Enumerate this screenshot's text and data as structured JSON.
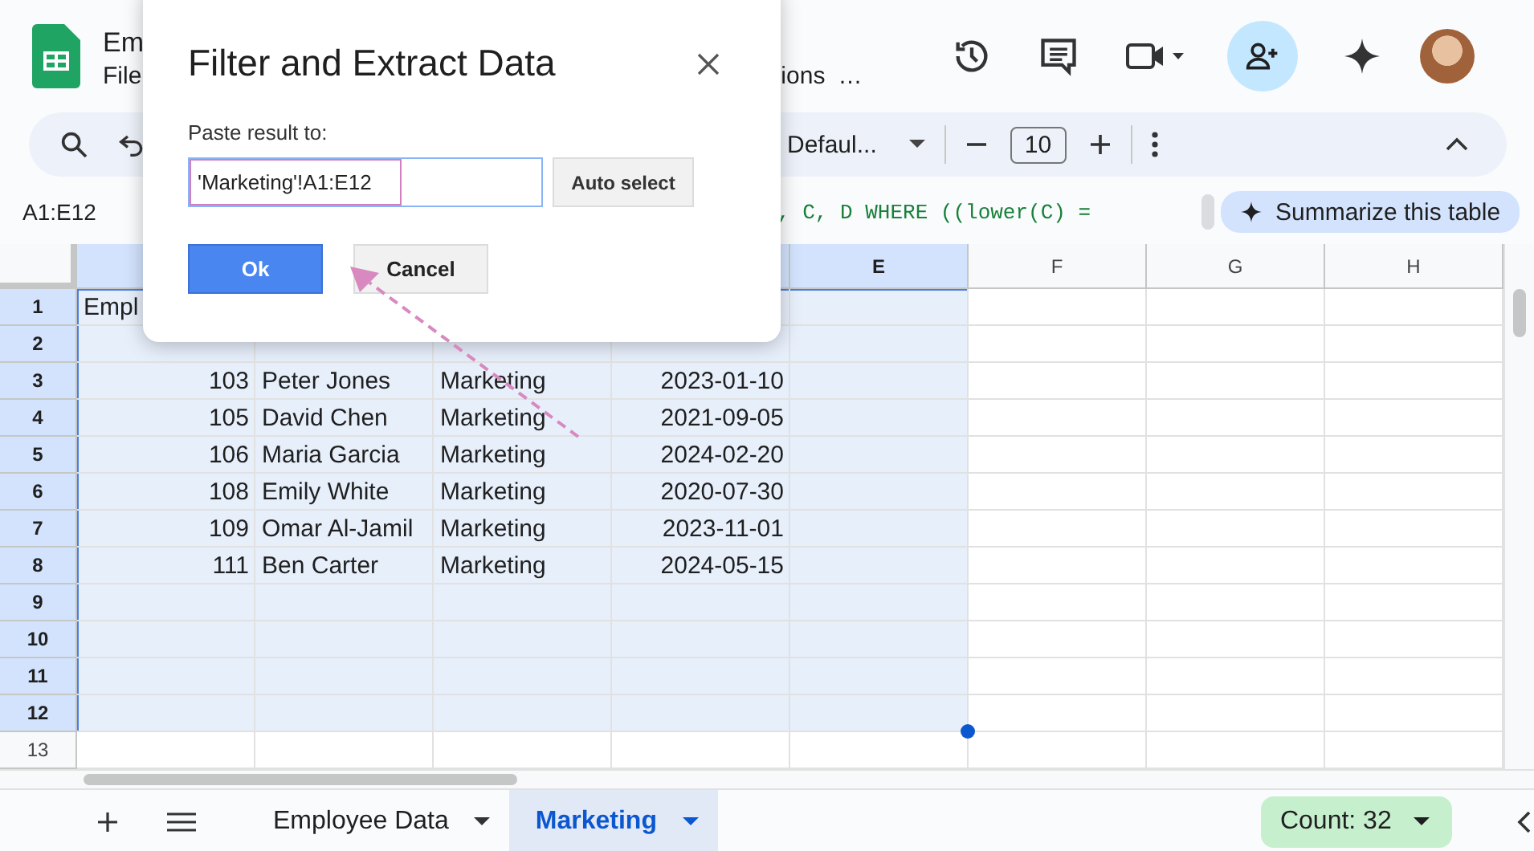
{
  "app": {
    "doc_title": "Em",
    "menu_start": "File",
    "menu_end": "ions",
    "menu_more": "…"
  },
  "toolbar": {
    "font": "Defaul...",
    "font_size": "10"
  },
  "formula_bar": {
    "name_box": "A1:E12",
    "formula": ", C, D WHERE ((lower(C) =",
    "summarize": "Summarize this table"
  },
  "grid": {
    "columns": [
      {
        "label": "E",
        "selected": true
      },
      {
        "label": "F",
        "selected": false
      },
      {
        "label": "G",
        "selected": false
      },
      {
        "label": "H",
        "selected": false
      }
    ],
    "rows": [
      {
        "number": "1",
        "selected": true,
        "kind": "text",
        "cells": [
          "Empl"
        ]
      },
      {
        "number": "2",
        "selected": true
      },
      {
        "number": "3",
        "selected": true,
        "kind": "record",
        "cells": [
          "103",
          "Peter Jones",
          "Marketing",
          "2023-01-10"
        ]
      },
      {
        "number": "4",
        "selected": true,
        "kind": "record",
        "cells": [
          "105",
          "David Chen",
          "Marketing",
          "2021-09-05"
        ]
      },
      {
        "number": "5",
        "selected": true,
        "kind": "record",
        "cells": [
          "106",
          "Maria Garcia",
          "Marketing",
          "2024-02-20"
        ]
      },
      {
        "number": "6",
        "selected": true,
        "kind": "record",
        "cells": [
          "108",
          "Emily White",
          "Marketing",
          "2020-07-30"
        ]
      },
      {
        "number": "7",
        "selected": true,
        "kind": "record",
        "cells": [
          "109",
          "Omar Al-Jamil",
          "Marketing",
          "2023-11-01"
        ]
      },
      {
        "number": "8",
        "selected": true,
        "kind": "record",
        "cells": [
          "111",
          "Ben Carter",
          "Marketing",
          "2024-05-15"
        ]
      },
      {
        "number": "9",
        "selected": true
      },
      {
        "number": "10",
        "selected": true
      },
      {
        "number": "11",
        "selected": true
      },
      {
        "number": "12",
        "selected": true
      },
      {
        "number": "13",
        "selected": false
      }
    ]
  },
  "sheet_tabs": [
    {
      "label": "Employee Data",
      "selected": false
    },
    {
      "label": "Marketing",
      "selected": true
    }
  ],
  "status": {
    "count": "Count: 32"
  },
  "dialog": {
    "title": "Filter and Extract Data",
    "field_label": "Paste result to:",
    "value": "'Marketing'!A1:E12",
    "auto_select": "Auto select",
    "ok": "Ok",
    "cancel": "Cancel"
  }
}
